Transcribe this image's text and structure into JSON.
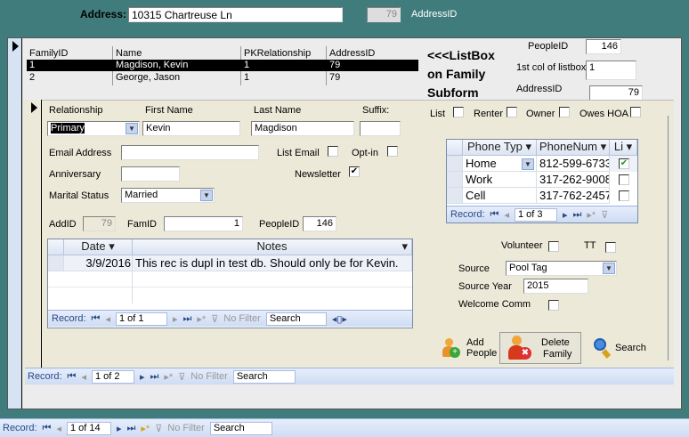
{
  "header": {
    "address_label": "Address:",
    "address_value": "10315 Chartreuse Ln",
    "address_id_value": "79",
    "address_id_label": "AddressID"
  },
  "listbox": {
    "columns": [
      "FamilyID",
      "Name",
      "PKRelationship",
      "AddressID"
    ],
    "rows": [
      [
        "1",
        "Magdison, Kevin",
        "1",
        "79"
      ],
      [
        "2",
        "George, Jason",
        "1",
        "79"
      ]
    ],
    "note": [
      "<<<ListBox",
      "on Family",
      "Subform"
    ],
    "people_id_label": "PeopleID",
    "people_id_value": "146",
    "first_col_label": "1st col of listbox",
    "first_col_value": "1",
    "address_id_label": "AddressID",
    "address_id_value": "79"
  },
  "person": {
    "relationship_label": "Relationship",
    "relationship_value": "Primary",
    "first_name_label": "First Name",
    "first_name_value": "Kevin",
    "last_name_label": "Last Name",
    "last_name_value": "Magdison",
    "suffix_label": "Suffix:",
    "suffix_value": "",
    "email_label": "Email Address",
    "email_value": "",
    "list_email_label": "List Email",
    "list_email_checked": false,
    "optin_label": "Opt-in",
    "optin_checked": false,
    "anniversary_label": "Anniversary",
    "anniversary_value": "",
    "newsletter_label": "Newsletter",
    "newsletter_checked": true,
    "marital_label": "Marital Status",
    "marital_value": "Married",
    "addid_label": "AddID",
    "addid_value": "79",
    "famid_label": "FamID",
    "famid_value": "1",
    "peopleid_label": "PeopleID",
    "peopleid_value": "146",
    "list_label": "List",
    "renter_label": "Renter",
    "owner_label": "Owner",
    "owes_hoa_label": "Owes HOA",
    "volunteer_label": "Volunteer",
    "tt_label": "TT",
    "source_label": "Source",
    "source_value": "Pool Tag",
    "source_year_label": "Source Year",
    "source_year_value": "2015",
    "welcome_label": "Welcome Comm"
  },
  "phones": {
    "columns": [
      "Phone Typ",
      "PhoneNum",
      "Li"
    ],
    "rows": [
      {
        "type": "Home",
        "num": "812-599-6733",
        "checked": "✔"
      },
      {
        "type": "Work",
        "num": "317-262-9008",
        "checked": ""
      },
      {
        "type": "Cell",
        "num": "317-762-2457",
        "checked": ""
      }
    ],
    "nav": {
      "record": "Record:",
      "pos": "1 of 3"
    }
  },
  "notes": {
    "columns": [
      "Date",
      "Notes"
    ],
    "rows": [
      {
        "date": "3/9/2016",
        "note": "This rec is dupl in test db. Should only be for Kevin."
      }
    ],
    "nav": {
      "record": "Record:",
      "pos": "1 of 1",
      "filter": "No Filter",
      "search": "Search"
    }
  },
  "buttons": {
    "add_people": [
      "Add",
      "People"
    ],
    "delete_family": [
      "Delete",
      "Family"
    ],
    "search": "Search"
  },
  "nav_family": {
    "record": "Record:",
    "pos": "1 of 2",
    "filter": "No Filter",
    "search": "Search"
  },
  "nav_main": {
    "record": "Record:",
    "pos": "1 of 14",
    "filter": "No Filter",
    "search": "Search"
  }
}
